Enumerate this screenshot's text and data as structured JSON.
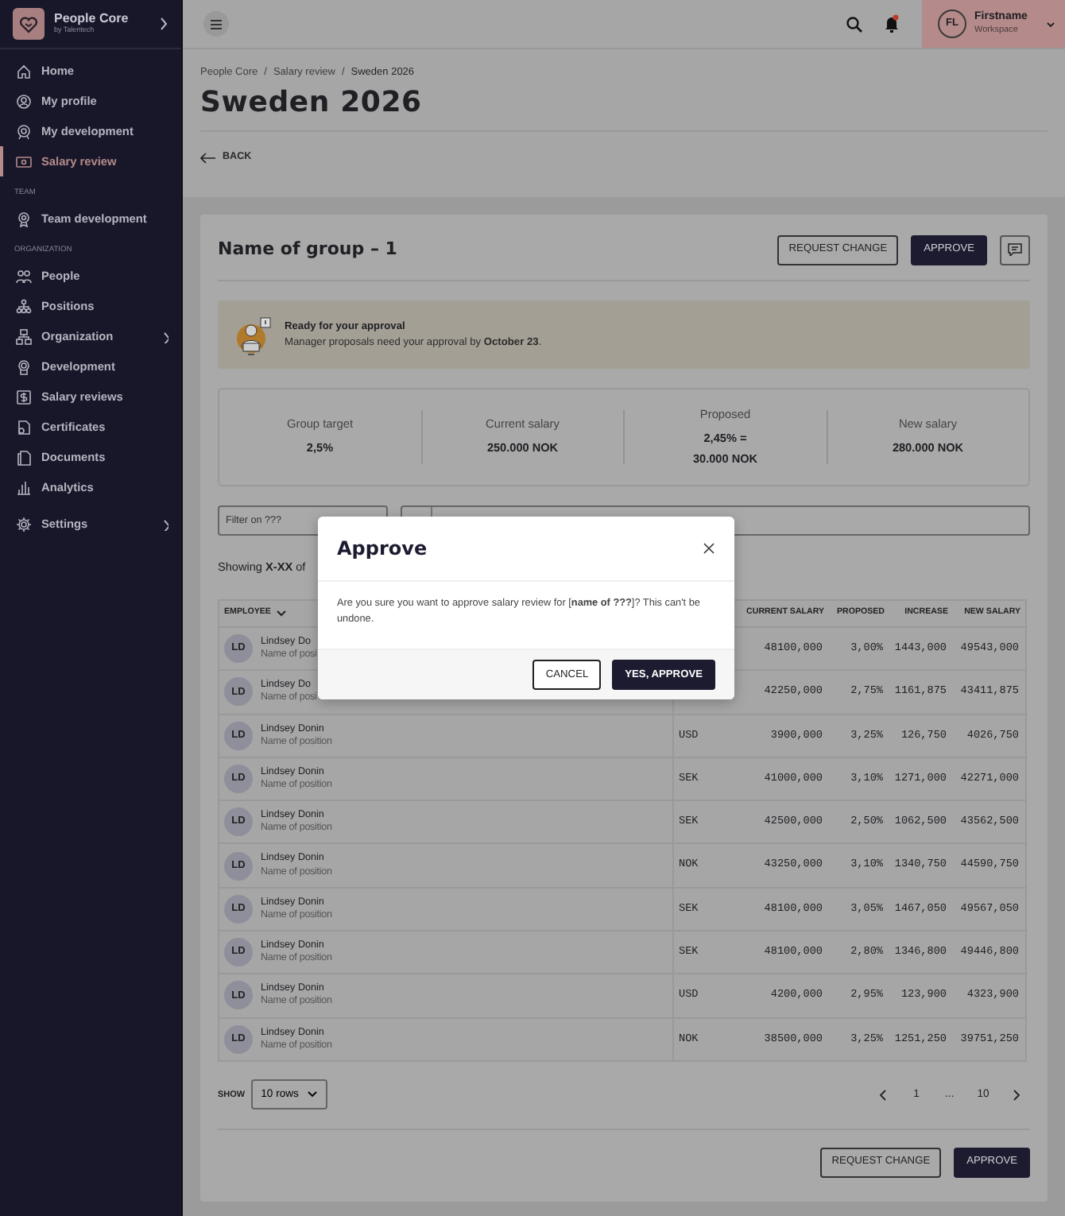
{
  "sidebar": {
    "brand": "People Core",
    "brand_sub": "by Talentech",
    "sections": [
      {
        "items": [
          {
            "label": "Home",
            "selected": false,
            "expandable": false
          },
          {
            "label": "My profile",
            "selected": false,
            "expandable": false
          },
          {
            "label": "My development",
            "selected": false,
            "expandable": false
          },
          {
            "label": "Salary review",
            "selected": true,
            "expandable": false
          }
        ]
      },
      {
        "heading": "TEAM",
        "items": [
          {
            "label": "Team development",
            "selected": false,
            "expandable": false
          }
        ]
      },
      {
        "heading": "ORGANIZATION",
        "items": [
          {
            "label": "People",
            "selected": false,
            "expandable": false
          },
          {
            "label": "Positions",
            "selected": false,
            "expandable": false
          },
          {
            "label": "Organization",
            "selected": false,
            "expandable": true
          },
          {
            "label": "Development",
            "selected": false,
            "expandable": false
          },
          {
            "label": "Salary reviews",
            "selected": false,
            "expandable": false
          },
          {
            "label": "Certificates",
            "selected": false,
            "expandable": false
          },
          {
            "label": "Documents",
            "selected": false,
            "expandable": false
          },
          {
            "label": "Analytics",
            "selected": false,
            "expandable": false
          }
        ]
      },
      {
        "items": [
          {
            "label": "Settings",
            "selected": false,
            "expandable": true
          }
        ]
      }
    ]
  },
  "topbar": {
    "has_notification": true,
    "user": {
      "initials": "FL",
      "name": "Firstname",
      "workspace": "Workspace"
    }
  },
  "breadcrumb": [
    "People Core",
    "Salary review",
    "Sweden 2026"
  ],
  "breadcrumb_separator": "/",
  "title": "Sweden 2026",
  "back": "BACK",
  "group": {
    "title": "Name of group – 1",
    "buttons": [
      "REQUEST CHANGE",
      "APPROVE"
    ]
  },
  "alert": {
    "title": "Ready for your approval",
    "text": "Manager proposals need your approval by **October 23**."
  },
  "stats": [
    {
      "label": "Group target",
      "values": [
        "2,5%"
      ]
    },
    {
      "label": "Current salary",
      "values": [
        "250.000 NOK"
      ]
    },
    {
      "label": "Proposed",
      "values": [
        "2,45% =",
        "30.000 NOK"
      ]
    },
    {
      "label": "New salary",
      "values": [
        "280.000 NOK"
      ]
    }
  ],
  "filter": {
    "placeholder": "Filter on ???"
  },
  "showing": "Showing **X-XX** of",
  "table": {
    "employee_column": "EMPLOYEE",
    "amount_columns": [
      "CURRENT SALARY",
      "PROPOSED",
      "INCREASE",
      "NEW SALARY"
    ],
    "rows": [
      {
        "initials": "LD",
        "name": "Lindsey Do",
        "position": "Name of posi",
        "amounts": [
          "48100,000",
          "3,00%",
          "1443,000",
          "49543,000"
        ]
      },
      {
        "initials": "LD",
        "name": "Lindsey Do",
        "position": "Name of posi",
        "amounts": [
          "42250,000",
          "2,75%",
          "1161,875",
          "43411,875"
        ]
      },
      {
        "initials": "LD",
        "name": "Lindsey Donin",
        "position": "Name of position",
        "currency": "USD",
        "amounts": [
          "3900,000",
          "3,25%",
          "126,750",
          "4026,750"
        ]
      },
      {
        "initials": "LD",
        "name": "Lindsey Donin",
        "position": "Name of position",
        "currency": "SEK",
        "amounts": [
          "41000,000",
          "3,10%",
          "1271,000",
          "42271,000"
        ]
      },
      {
        "initials": "LD",
        "name": "Lindsey Donin",
        "position": "Name of position",
        "currency": "SEK",
        "amounts": [
          "42500,000",
          "2,50%",
          "1062,500",
          "43562,500"
        ]
      },
      {
        "initials": "LD",
        "name": "Lindsey Donin",
        "position": "Name of position",
        "currency": "NOK",
        "amounts": [
          "43250,000",
          "3,10%",
          "1340,750",
          "44590,750"
        ]
      },
      {
        "initials": "LD",
        "name": "Lindsey Donin",
        "position": "Name of position",
        "currency": "SEK",
        "amounts": [
          "48100,000",
          "3,05%",
          "1467,050",
          "49567,050"
        ]
      },
      {
        "initials": "LD",
        "name": "Lindsey Donin",
        "position": "Name of position",
        "currency": "SEK",
        "amounts": [
          "48100,000",
          "2,80%",
          "1346,800",
          "49446,800"
        ]
      },
      {
        "initials": "LD",
        "name": "Lindsey Donin",
        "position": "Name of position",
        "currency": "USD",
        "amounts": [
          "4200,000",
          "2,95%",
          "123,900",
          "4323,900"
        ]
      },
      {
        "initials": "LD",
        "name": "Lindsey Donin",
        "position": "Name of position",
        "currency": "NOK",
        "amounts": [
          "38500,000",
          "3,25%",
          "1251,250",
          "39751,250"
        ]
      }
    ]
  },
  "pager": {
    "show_label": "SHOW",
    "rows_option": "10 rows",
    "pages": [
      "1",
      "...",
      "10"
    ]
  },
  "footer_buttons": [
    "REQUEST CHANGE",
    "APPROVE"
  ],
  "modal": {
    "title": "Approve",
    "text": "Are you sure you want to approve salary review for [**name of ???**]? This can't be undone.",
    "buttons": [
      "CANCEL",
      "YES, APPROVE"
    ]
  }
}
